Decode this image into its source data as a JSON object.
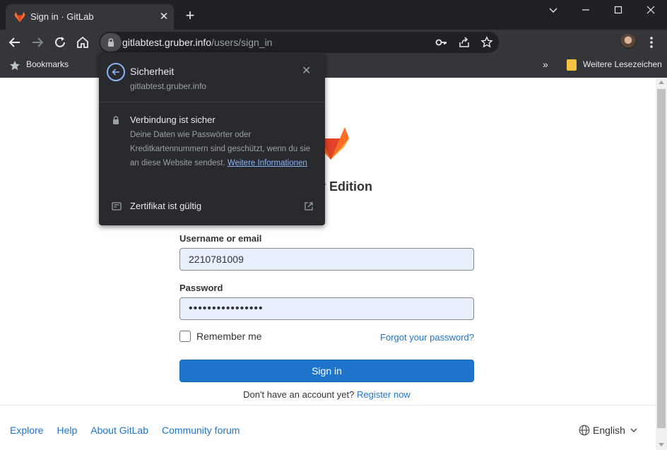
{
  "browser": {
    "tab_title": "Sign in · GitLab",
    "url_host": "gitlabtest.gruber.info",
    "url_path": "/users/sign_in",
    "bookmarks_label": "Bookmarks",
    "other_bookmarks_label": "Weitere Lesezeichen",
    "overflow_chevron": "»"
  },
  "security_popup": {
    "title": "Sicherheit",
    "host": "gitlabtest.gruber.info",
    "connection_title": "Verbindung ist sicher",
    "connection_desc": "Deine Daten wie Passwörter oder Kreditkartennummern sind geschützt, wenn du sie an diese Website sendest.",
    "more_info_link": "Weitere Informationen",
    "certificate_label": "Zertifikat ist gültig"
  },
  "page": {
    "edition_title": "nunity Edition",
    "username_label": "Username or email",
    "username_value": "2210781009",
    "password_label": "Password",
    "password_value": "••••••••••••••••",
    "remember_label": "Remember me",
    "forgot_link": "Forgot your password?",
    "signin_button": "Sign in",
    "no_account_text": "Don't have an account yet?",
    "register_link": "Register now"
  },
  "footer": {
    "links": [
      "Explore",
      "Help",
      "About GitLab",
      "Community forum"
    ],
    "language": "English"
  },
  "colors": {
    "accent": "#1f75cb",
    "chrome_bg": "#202124",
    "popup_bg": "#292a2d",
    "gitlab_orange": "#fc6d26"
  }
}
